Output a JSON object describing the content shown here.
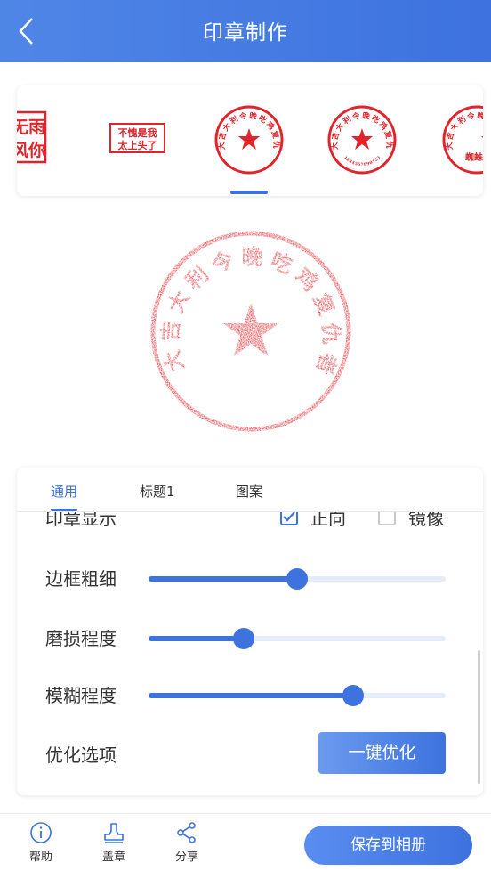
{
  "header": {
    "title": "印章制作"
  },
  "templates": {
    "items": [
      {
        "lines": [
          "无雨",
          "风你"
        ]
      },
      {
        "lines": [
          "不愧是我",
          "太上头了"
        ]
      },
      {
        "ring_text": "大吉大利今晚吃鸡复仇者联盟"
      },
      {
        "ring_text": "大吉大利今晚吃鸡复仇者联盟",
        "bottom_code": "1234567890123"
      },
      {
        "ring_text": "大吉大利今晚吃鸡复仇者联盟",
        "bottom_text": "蜘蛛"
      }
    ]
  },
  "preview": {
    "ring_text": "大吉大利今晚吃鸡复仇者联盟"
  },
  "panel": {
    "tabs": [
      {
        "label": "通用",
        "active": true
      },
      {
        "label": "标题1",
        "active": false
      },
      {
        "label": "图案",
        "active": false
      }
    ],
    "stamp_display": {
      "label": "印章显示",
      "options": [
        {
          "label": "正向",
          "checked": true
        },
        {
          "label": "镜像",
          "checked": false
        }
      ]
    },
    "sliders": [
      {
        "label": "边框粗细",
        "value": 0.5
      },
      {
        "label": "磨损程度",
        "value": 0.32
      },
      {
        "label": "模糊程度",
        "value": 0.69
      }
    ],
    "optimize": {
      "label": "优化选项",
      "button": "一键优化"
    }
  },
  "bottom_bar": {
    "nav": [
      {
        "label": "帮助",
        "icon": "info-icon"
      },
      {
        "label": "盖章",
        "icon": "stamp-icon"
      },
      {
        "label": "分享",
        "icon": "share-icon"
      }
    ],
    "save_button": "保存到相册"
  },
  "colors": {
    "accent": "#3d72df",
    "stamp_red": "#e0242a"
  }
}
